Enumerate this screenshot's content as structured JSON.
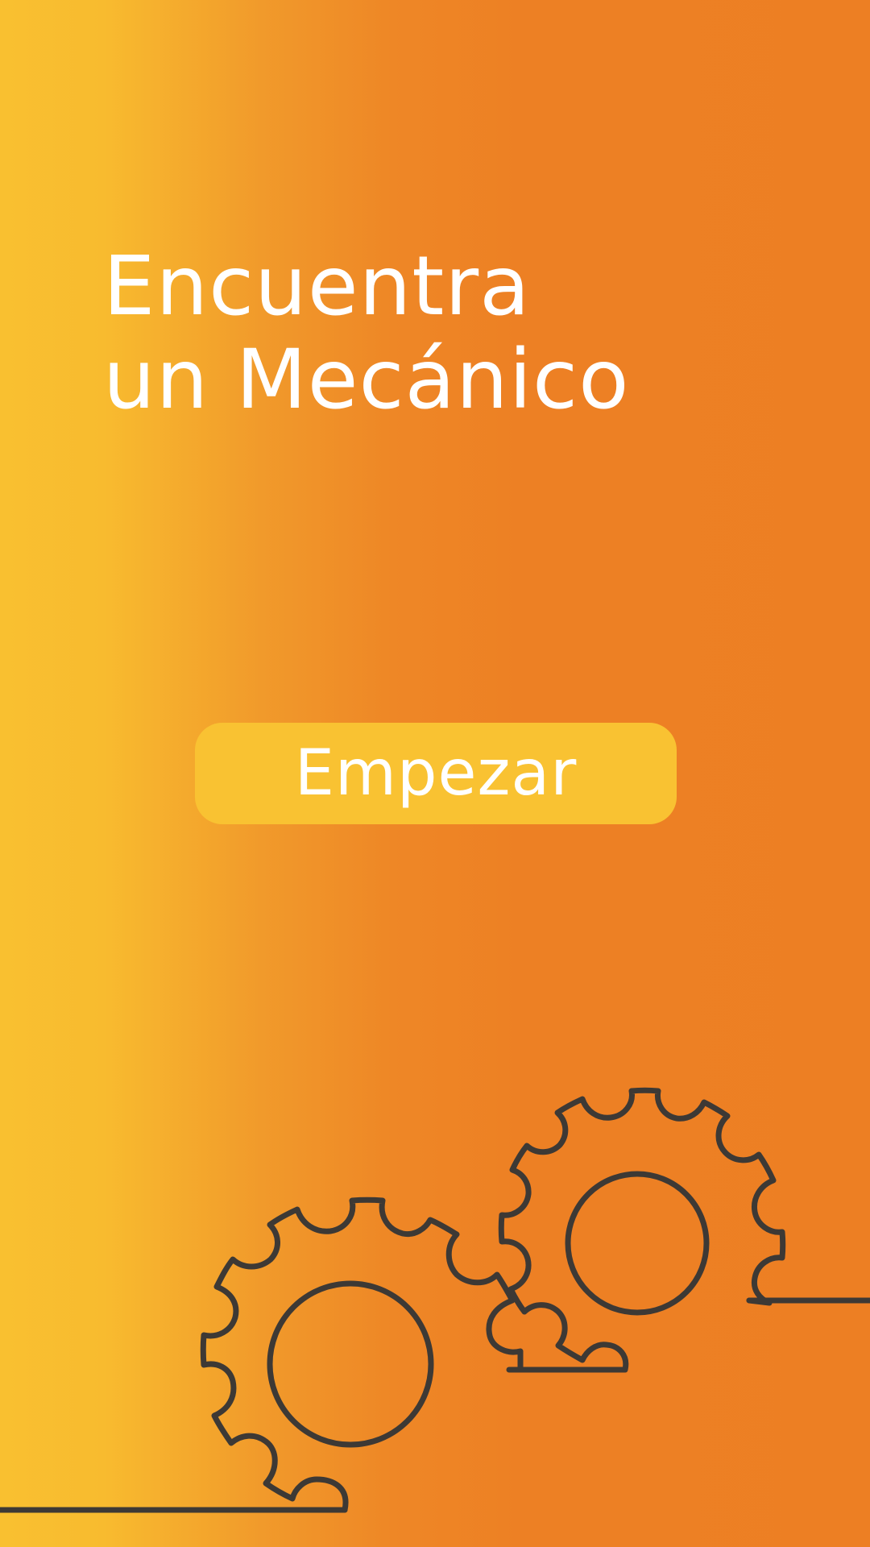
{
  "screen": {
    "title_line1": "Encuentra",
    "title_line2": "un Mecánico",
    "start_button_label": "Empezar"
  },
  "illustration": {
    "icon": "gears-illustration",
    "stroke_color": "#3d3935"
  },
  "colors": {
    "gradient_start": "#f9c030",
    "gradient_end": "#ed7f23",
    "button_background": "#f9c232",
    "text": "#ffffff"
  }
}
